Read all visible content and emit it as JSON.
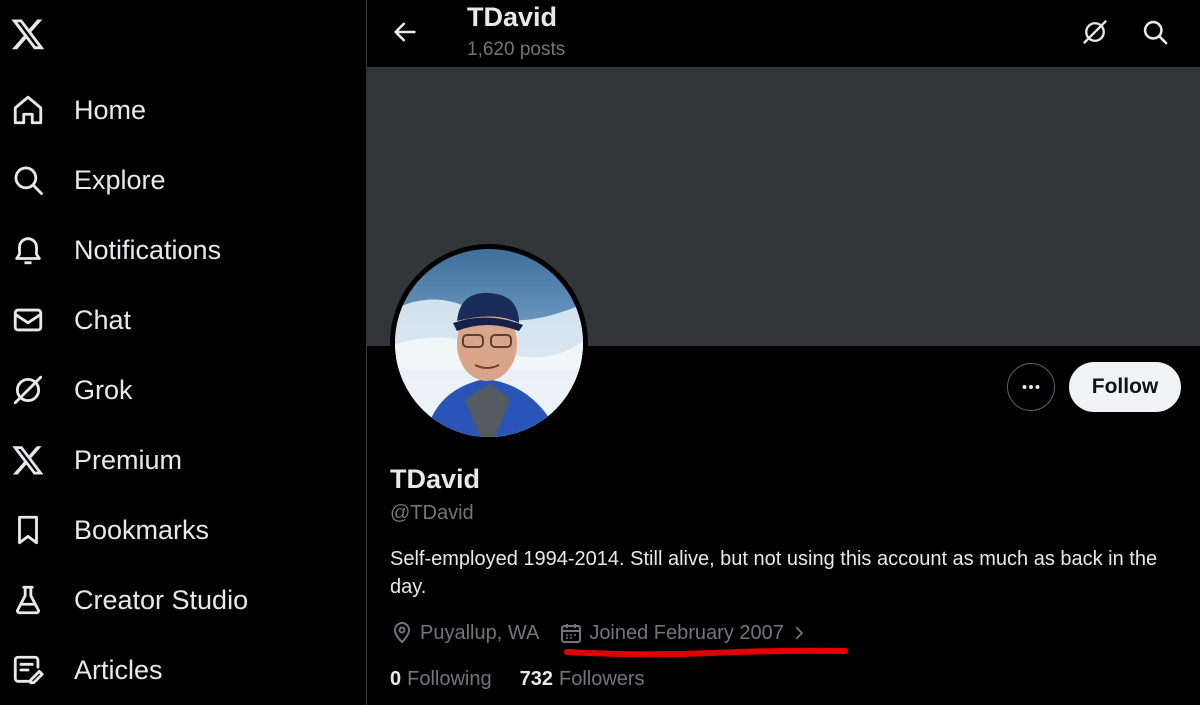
{
  "sidebar": {
    "logo_icon": "x-logo-icon",
    "items": [
      {
        "label": "Home",
        "icon": "home-icon"
      },
      {
        "label": "Explore",
        "icon": "search-icon"
      },
      {
        "label": "Notifications",
        "icon": "bell-icon"
      },
      {
        "label": "Chat",
        "icon": "envelope-icon"
      },
      {
        "label": "Grok",
        "icon": "grok-icon"
      },
      {
        "label": "Premium",
        "icon": "x-logo-icon"
      },
      {
        "label": "Bookmarks",
        "icon": "bookmark-icon"
      },
      {
        "label": "Creator Studio",
        "icon": "flask-icon"
      },
      {
        "label": "Articles",
        "icon": "article-edit-icon"
      }
    ]
  },
  "header": {
    "name": "TDavid",
    "posts": "1,620 posts",
    "back_icon": "arrow-left-icon",
    "grok_icon": "grok-icon",
    "search_icon": "search-icon"
  },
  "profile": {
    "display_name": "TDavid",
    "handle": "@TDavid",
    "bio": "Self-employed 1994-2014.  Still alive, but not using this account as much as back in the day.",
    "location": "Puyallup, WA",
    "joined": "Joined February 2007",
    "following_count": "0",
    "following_label": "Following",
    "followers_count": "732",
    "followers_label": "Followers",
    "follow_label": "Follow",
    "more_icon": "more-dots-icon"
  },
  "colors": {
    "background": "#000000",
    "banner": "#333639",
    "text_primary": "#e7e9ea",
    "text_secondary": "#71767b",
    "follow_button_bg": "#eff3f4",
    "annotation_red": "#e00000"
  }
}
